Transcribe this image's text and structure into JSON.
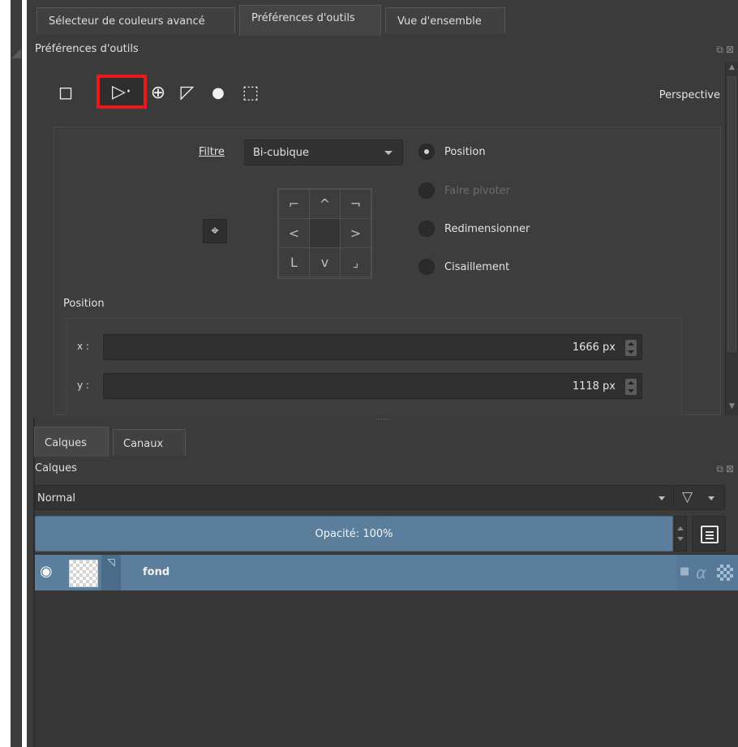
{
  "top_tabs": [
    {
      "label": "Sélecteur de couleurs avancé",
      "active": false
    },
    {
      "label": "Préférences d'outils",
      "active": true
    },
    {
      "label": "Vue d'ensemble",
      "active": false
    }
  ],
  "tool_panel": {
    "title": "Préférences d'outils",
    "float_buttons": "⧉⊠",
    "tools": [
      {
        "icon": "free-transform-icon",
        "glyph": "◻",
        "selected": false
      },
      {
        "icon": "perspective-transform-icon",
        "glyph": "▷·",
        "selected": true
      },
      {
        "icon": "warp-transform-icon",
        "glyph": "⊕",
        "selected": false
      },
      {
        "icon": "cage-transform-icon",
        "glyph": "◸",
        "selected": false
      },
      {
        "icon": "liquify-transform-icon",
        "glyph": "●",
        "selected": false
      },
      {
        "icon": "mesh-transform-icon",
        "glyph": "⬚",
        "selected": false
      }
    ],
    "mode_label": "Perspective",
    "filter_label": "Filtre",
    "filter_value": "Bi-cubique",
    "radios": [
      {
        "label": "Position",
        "checked": true,
        "disabled": false
      },
      {
        "label": "Faire pivoter",
        "checked": false,
        "disabled": true
      },
      {
        "label": "Redimensionner",
        "checked": false,
        "disabled": false
      },
      {
        "label": "Cisaillement",
        "checked": false,
        "disabled": false
      }
    ],
    "anchor_pad": [
      "⌐",
      "^",
      "¬",
      "<",
      "",
      ">",
      "L",
      "v",
      "⌟"
    ],
    "position_section": "Position",
    "x_label": "x :",
    "x_value": "1666 px",
    "y_label": "y :",
    "y_value": "1118 px"
  },
  "bottom_tabs": [
    {
      "label": "Calques",
      "active": true
    },
    {
      "label": "Canaux",
      "active": false
    }
  ],
  "layers_panel": {
    "title": "Calques",
    "float_buttons": "⧉⊠",
    "blend_mode": "Normal",
    "opacity_text": "Opacité:  100%",
    "layers": [
      {
        "name": "fond",
        "visible": true
      }
    ]
  },
  "colors": {
    "panel_bg": "#3b3b3b",
    "selection_blue": "#5b7e9c",
    "highlight_red": "#e8191b"
  }
}
